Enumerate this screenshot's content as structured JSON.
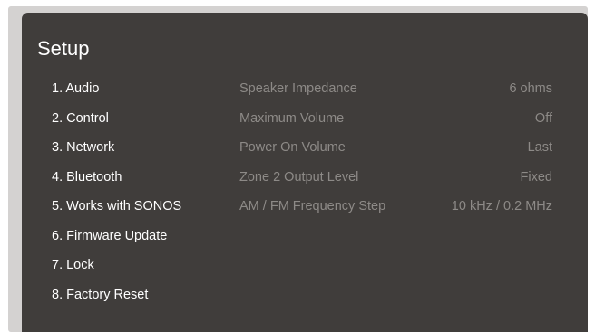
{
  "title": "Setup",
  "menu": [
    {
      "label": "1. Audio",
      "selected": true
    },
    {
      "label": "2. Control",
      "selected": false
    },
    {
      "label": "3. Network",
      "selected": false
    },
    {
      "label": "4. Bluetooth",
      "selected": false
    },
    {
      "label": "5. Works with SONOS",
      "selected": false
    },
    {
      "label": "6. Firmware Update",
      "selected": false
    },
    {
      "label": "7. Lock",
      "selected": false
    },
    {
      "label": "8. Factory Reset",
      "selected": false
    }
  ],
  "settings": [
    {
      "label": "Speaker Impedance",
      "value": "6 ohms"
    },
    {
      "label": "Maximum Volume",
      "value": "Off"
    },
    {
      "label": "Power On Volume",
      "value": "Last"
    },
    {
      "label": "Zone 2 Output Level",
      "value": "Fixed"
    },
    {
      "label": "AM / FM Frequency Step",
      "value": "10 kHz / 0.2 MHz"
    }
  ],
  "colors": {
    "screen_bg": "#403d3b",
    "frame_bg": "#d4d2d1",
    "text_primary": "#ffffff",
    "text_dim": "#8d8a87"
  }
}
